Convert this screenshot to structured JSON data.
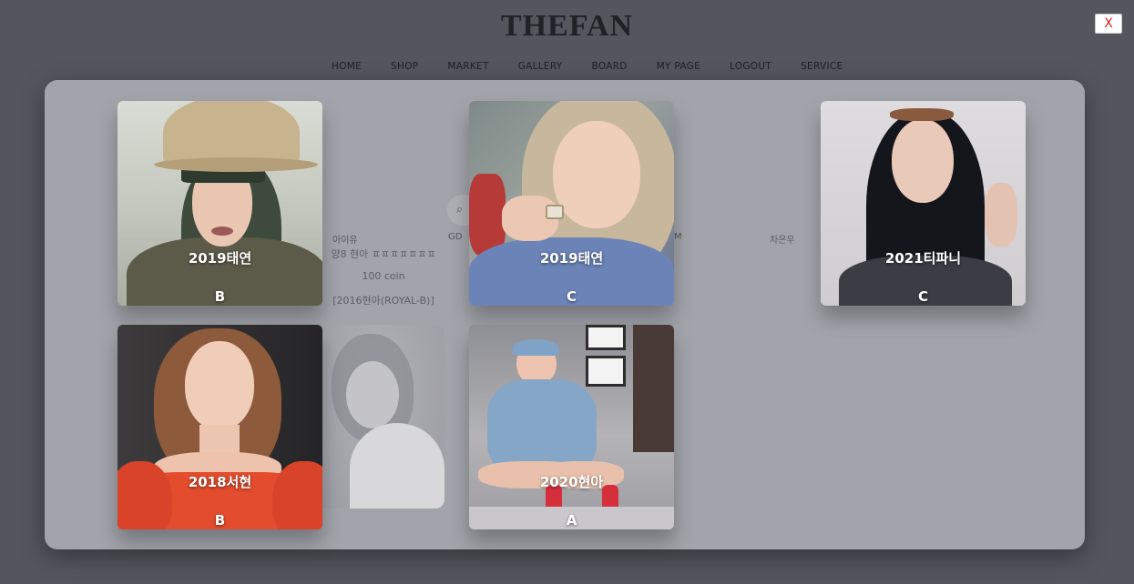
{
  "logo": "THEFAN",
  "nav": [
    "HOME",
    "SHOP",
    "MARKET",
    "GALLERY",
    "BOARD",
    "MY PAGE",
    "LOGOUT",
    "SERVICE"
  ],
  "background": {
    "categories": [
      "아이유",
      "GD",
      "M",
      "차은우"
    ],
    "product_title": "양8 현아 ㅍㅍㅍㅍㅍㅍㅍ",
    "product_price": "100 coin",
    "product_code": "[2016현아(ROYAL-B)]"
  },
  "close_label": "X",
  "cards": [
    {
      "name": "2019태연",
      "grade": "B",
      "icon": "photo-girl-cap"
    },
    {
      "name": "2019태연",
      "grade": "C",
      "icon": "photo-blonde-smile"
    },
    {
      "name": "2021티파니",
      "grade": "C",
      "icon": "photo-dark-hair"
    },
    {
      "name": "2018서현",
      "grade": "B",
      "icon": "photo-red-dress"
    },
    {
      "name": "2020현아",
      "grade": "A",
      "icon": "photo-denim-crouch"
    }
  ],
  "colors": {
    "overlay_bg": "#54555d",
    "modal_bg": "#a8aab2",
    "close_text": "#dd2222",
    "card_text": "#ffffff"
  }
}
